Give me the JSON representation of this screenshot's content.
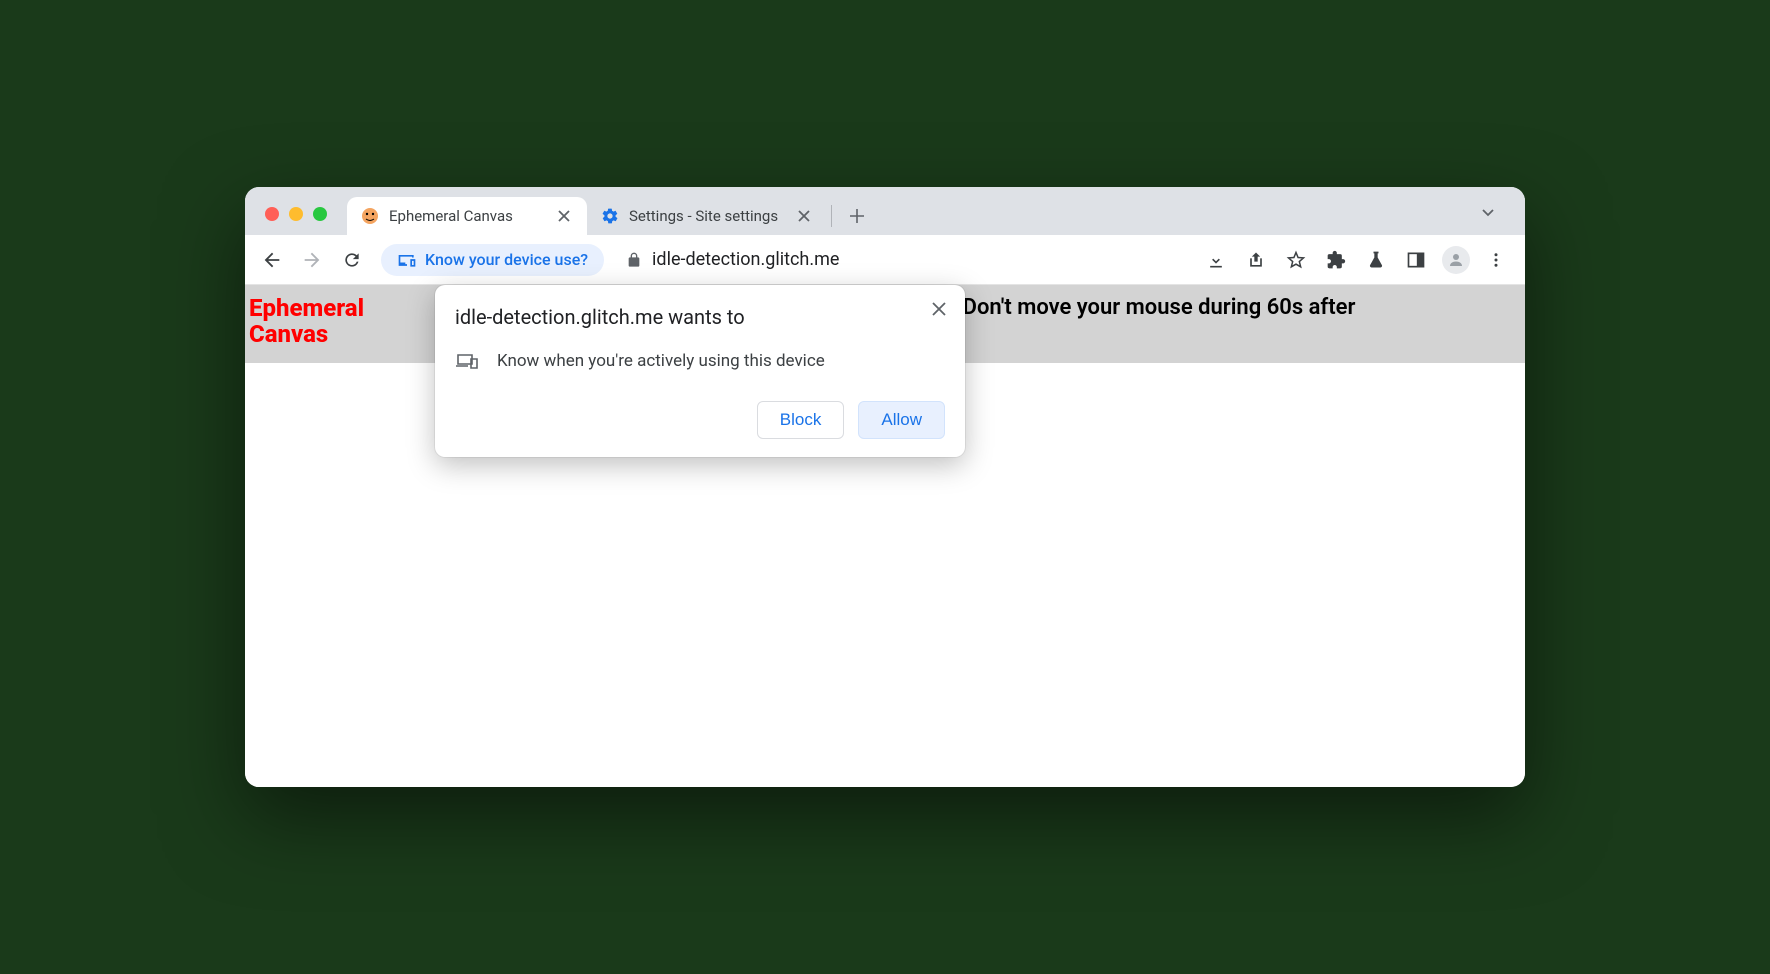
{
  "tabs": [
    {
      "title": "Ephemeral Canvas",
      "active": true
    },
    {
      "title": "Settings - Site settings",
      "active": false
    }
  ],
  "chip": {
    "label": "Know your device use?"
  },
  "address": "idle-detection.glitch.me",
  "page": {
    "banner_title_line1": "Ephemeral",
    "banner_title_line2": "Canvas",
    "banner_text": "(Don't move your mouse during 60s after"
  },
  "permission": {
    "title": "idle-detection.glitch.me wants to",
    "detail": "Know when you're actively using this device",
    "block": "Block",
    "allow": "Allow"
  }
}
